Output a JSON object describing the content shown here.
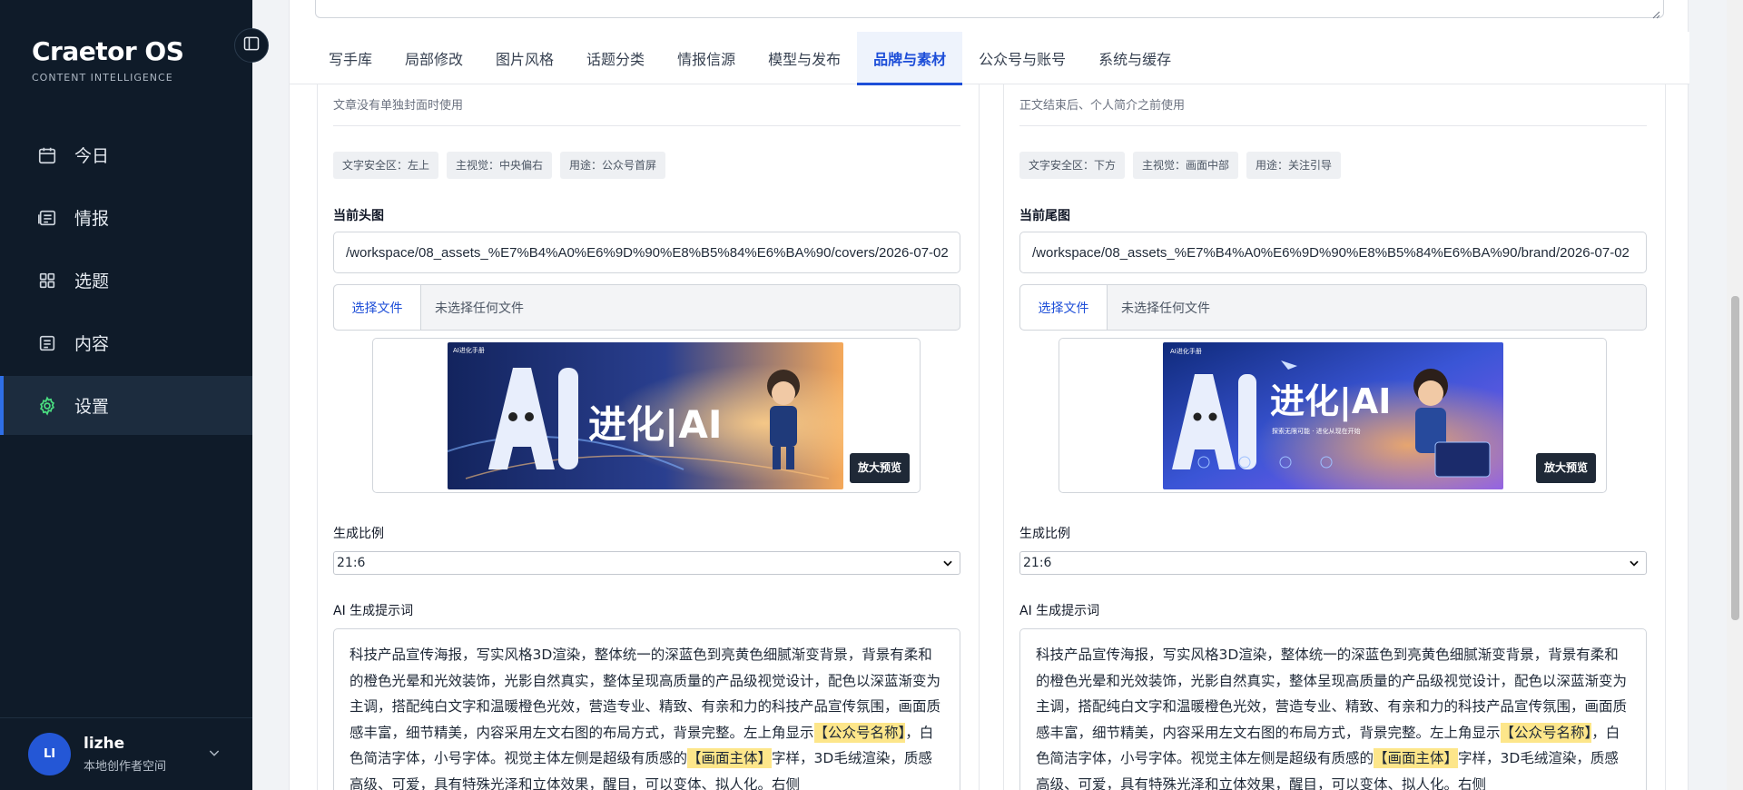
{
  "sidebar": {
    "brand_title": "Craetor OS",
    "brand_subtitle": "CONTENT INTELLIGENCE",
    "items": [
      {
        "label": "今日",
        "icon": "calendar-icon"
      },
      {
        "label": "情报",
        "icon": "news-icon"
      },
      {
        "label": "选题",
        "icon": "grid-icon"
      },
      {
        "label": "内容",
        "icon": "document-icon"
      },
      {
        "label": "设置",
        "icon": "gear-icon",
        "active": true
      }
    ],
    "user": {
      "initials": "LI",
      "name": "lizhe",
      "workspace": "本地创作者空间"
    }
  },
  "tabs": [
    "写手库",
    "局部修改",
    "图片风格",
    "话题分类",
    "情报信源",
    "模型与发布",
    "品牌与素材",
    "公众号与账号",
    "系统与缓存"
  ],
  "active_tab": "品牌与素材",
  "panels": {
    "left": {
      "description": "文章没有单独封面时使用",
      "tags": [
        "文字安全区：左上",
        "主视觉：中央偏右",
        "用途：公众号首屏"
      ],
      "current_label": "当前头图",
      "path": "/workspace/08_assets_%E7%B4%A0%E6%9D%90%E8%B5%84%E6%BA%90/covers/2026-07-02",
      "choose_file": "选择文件",
      "file_status": "未选择任何文件",
      "image_caption": "AI进化手册",
      "image_title": "进化|AI",
      "zoom_button": "放大预览",
      "ratio_label": "生成比例",
      "ratio_value": "21:6",
      "prompt_label": "AI 生成提示词",
      "prompt_parts": {
        "p1": "科技产品宣传海报，写实风格3D渲染，整体统一的深蓝色到亮黄色细腻渐变背景，背景有柔和的橙色光晕和光效装饰，光影自然真实，整体呈现高质量的产品级视觉设计，配色以深蓝渐变为主调，搭配纯白文字和温暖橙色光效，营造专业、精致、有亲和力的科技产品宣传氛围，画面质感丰富，细节精美，内容采用左文右图的布局方式，背景完整。左上角显示",
        "h1": "【公众号名称】",
        "p2": "，白色简洁字体，小号字体。视觉主体左侧是超级有质感的",
        "h2": "【画面主体】",
        "p3": "字样，3D毛绒渲染，质感高级、可爱，具有特殊光泽和立体效果，醒目，可以变体、拟人化。右侧"
      }
    },
    "right": {
      "description": "正文结束后、个人简介之前使用",
      "tags": [
        "文字安全区：下方",
        "主视觉：画面中部",
        "用途：关注引导"
      ],
      "current_label": "当前尾图",
      "path": "/workspace/08_assets_%E7%B4%A0%E6%9D%90%E8%B5%84%E6%BA%90/brand/2026-07-02",
      "choose_file": "选择文件",
      "file_status": "未选择任何文件",
      "image_caption": "AI进化手册",
      "image_title": "进化|AI",
      "image_subtitle": "探索无限可能 · 进化从现在开始",
      "zoom_button": "放大预览",
      "ratio_label": "生成比例",
      "ratio_value": "21:6",
      "prompt_label": "AI 生成提示词",
      "prompt_parts": {
        "p1": "科技产品宣传海报，写实风格3D渲染，整体统一的深蓝色到亮黄色细腻渐变背景，背景有柔和的橙色光晕和光效装饰，光影自然真实，整体呈现高质量的产品级视觉设计，配色以深蓝渐变为主调，搭配纯白文字和温暖橙色光效，营造专业、精致、有亲和力的科技产品宣传氛围，画面质感丰富，细节精美，内容采用左文右图的布局方式，背景完整。左上角显示",
        "h1": "【公众号名称】",
        "p2": "，白色简洁字体，小号字体。视觉主体左侧是超级有质感的",
        "h2": "【画面主体】",
        "p3": "字样，3D毛绒渲染，质感高级、可爱，具有特殊光泽和立体效果，醒目，可以变体、拟人化。右侧"
      }
    }
  },
  "colors": {
    "sidebar_bg": "#0f1b29",
    "accent": "#1d4ed8",
    "highlight": "#fde68a"
  }
}
